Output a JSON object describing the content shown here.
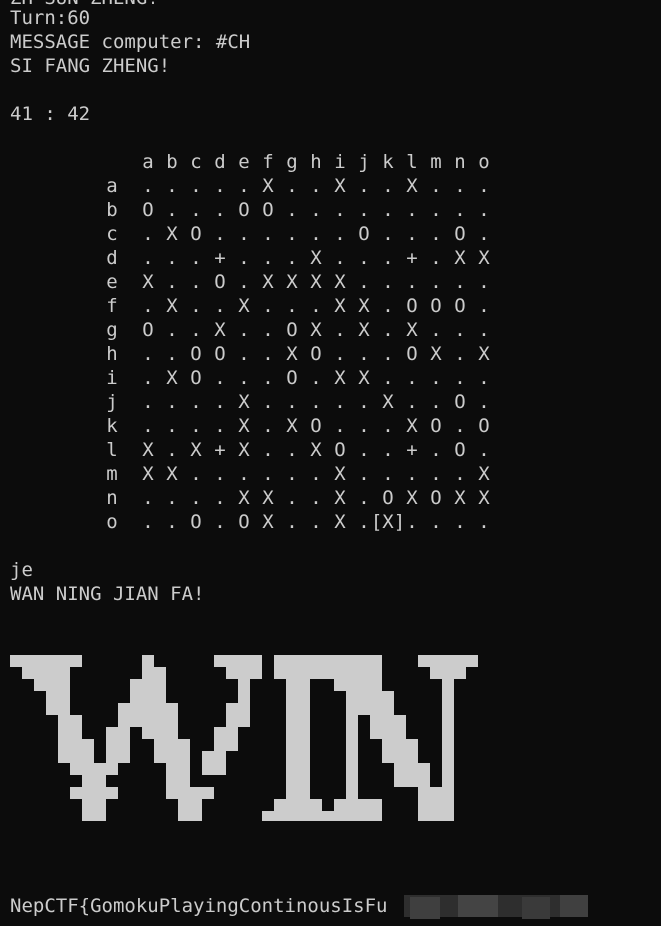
{
  "terminal": {
    "partial_top": "ZH SUN ZHENG!",
    "turn": "Turn:60",
    "message": "MESSAGE computer: #CH",
    "status_1": "SI FANG ZHENG!",
    "score": "41 : 42",
    "input_echo": "je",
    "result_message": "WAN NING JIAN FA!",
    "flag_visible": "NepCTF{GomokuPlayingContinousIsFu",
    "win_banner_text": "WIN"
  },
  "board": {
    "columns": [
      "a",
      "b",
      "c",
      "d",
      "e",
      "f",
      "g",
      "h",
      "i",
      "j",
      "k",
      "l",
      "m",
      "n",
      "o"
    ],
    "rows": [
      "a",
      "b",
      "c",
      "d",
      "e",
      "f",
      "g",
      "h",
      "i",
      "j",
      "k",
      "l",
      "m",
      "n",
      "o"
    ],
    "grid": [
      ". . . . . X . . X . . X . . .",
      "O . . . O O . . . . . . . . .",
      ". X O . . . . . . O . . . O .",
      ". . . + . . . X . . . + . X X",
      "X . . O . X X X X . . . . . .",
      ". X . . X . . . X X . O O O .",
      "O . . X . . O X . X . X . . .",
      ". . O O . . X O . . . O X . X",
      ". X O . . . O . X X . . . . .",
      ". . . . X . . . . . X . . O .",
      ". . . . X . X O . . . X O . O",
      "X . X + X . . X O . . + . O .",
      "X X . . . . . . X . . . . . X",
      ". . . . X X . . X . O X O X X .",
      ". . O . O X . . X . X . . . ."
    ],
    "cursor_row": 14,
    "cursor_col": 10,
    "cursor_mark": "X"
  },
  "colors": {
    "background": "#0c0c0c",
    "text": "#cccccc",
    "banner": "#cccccc",
    "blur": "#3a3a3a"
  }
}
